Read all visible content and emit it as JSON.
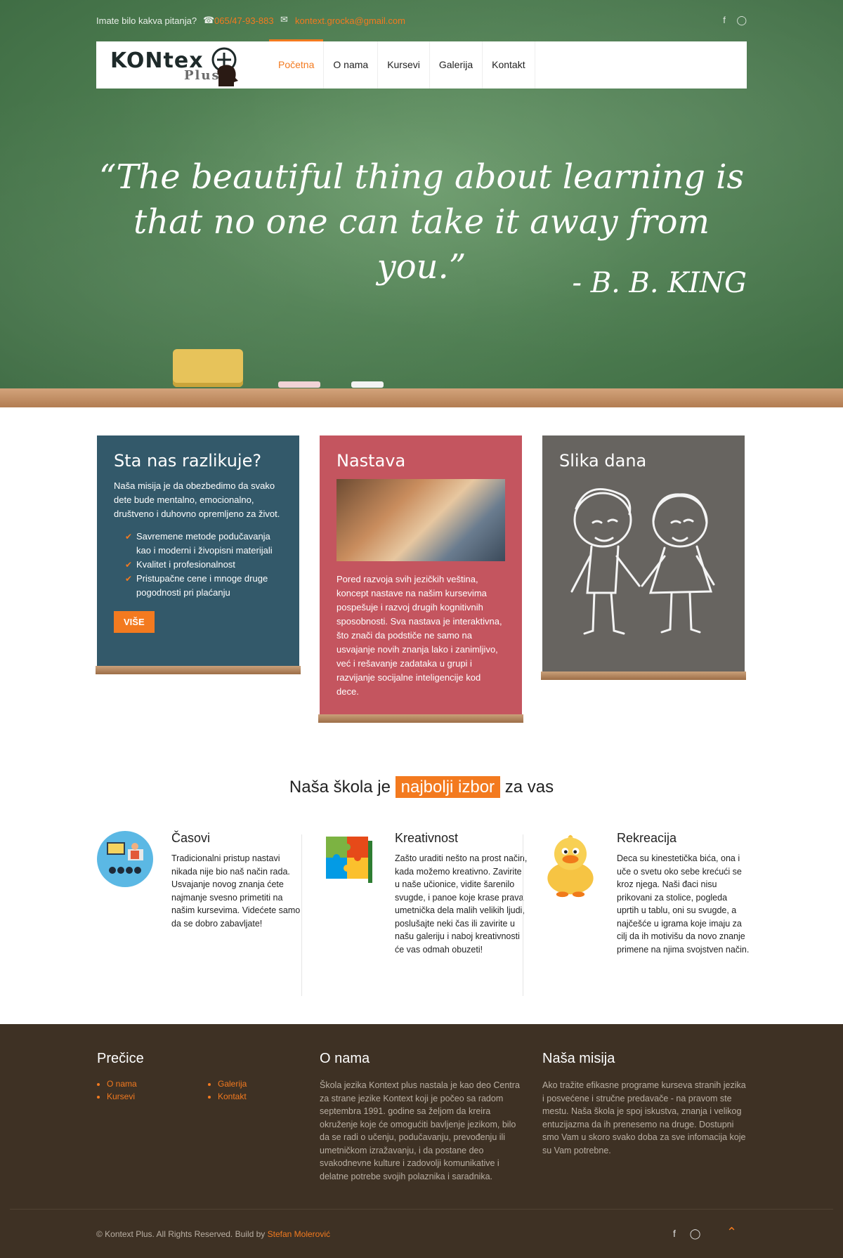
{
  "topbar": {
    "question": "Imate bilo kakva pitanja?",
    "phone": "065/47-93-883",
    "email": "kontext.grocka@gmail.com",
    "social": [
      "facebook-icon",
      "instagram-icon"
    ]
  },
  "logo": {
    "line1": "KONtex",
    "line2": "Plus"
  },
  "nav": [
    {
      "label": "Početna",
      "active": true
    },
    {
      "label": "O nama"
    },
    {
      "label": "Kursevi"
    },
    {
      "label": "Galerija"
    },
    {
      "label": "Kontakt"
    }
  ],
  "hero": {
    "quote": "“The beautiful thing about learning is that no one can take it away from you.”",
    "author": "- B. B. KING"
  },
  "cards": {
    "card1": {
      "title": "Sta nas razlikuje?",
      "text": "Naša misija je da obezbedimo da svako dete bude mentalno, emocionalno, društveno i duhovno opremljeno za život.",
      "checks": [
        "Savremene metode podučavanja kao i moderni i živopisni materijali",
        "Kvalitet i profesionalnost",
        "Pristupačne cene i mnoge druge pogodnosti pri plaćanju"
      ],
      "button": "VIŠE",
      "color": "#33596a"
    },
    "card2": {
      "title": "Nastava",
      "text": "Pored razvoja svih jezičkih veština, koncept nastave na našim kursevima pospešuje i razvoj drugih kognitivnih sposobnosti. Sva nastava je interaktivna, što znači da podstiče ne samo na usvajanje novih znanja lako i zanimljivo, već i rešavanje zadataka u grupi i razvijanje socijalne inteligencije kod dece.",
      "color": "#c4555f"
    },
    "card3": {
      "title": "Slika dana",
      "color": "#676460"
    }
  },
  "school": {
    "title_pre": "Naša škola je",
    "title_hl": "najbolji izbor",
    "title_post": "za vas",
    "features": [
      {
        "title": "Časovi",
        "icon": "classroom-icon",
        "text": "Tradicionalni pristup nastavi nikada nije bio naš način rada. Usvajanje novog znanja ćete najmanje svesno primetiti na našim kursevima. Videćete samo da se dobro zabavljate!"
      },
      {
        "title": "Kreativnost",
        "icon": "puzzle-icon",
        "text": "Zašto uraditi nešto na prost način, kada možemo kreativno. Zavirite u naše učionice, vidite šarenilo svugde, i panoe koje krase prava umetnička dela malih velikih ljudi, poslušajte neki čas ili zavirite u našu galeriju i naboj kreativnosti će vas odmah obuzeti!"
      },
      {
        "title": "Rekreacija",
        "icon": "duck-icon",
        "text": "Deca su kinestetička bića, ona i uče o svetu oko sebe krećući se kroz njega. Naši đaci nisu prikovani za stolice, pogleda uprtih u tablu, oni su svugde, a najčešće u igrama koje imaju za cilj da ih motivišu da novo znanje primene na njima svojstven način."
      }
    ]
  },
  "footer": {
    "shortcuts_title": "Prečice",
    "links_col1": [
      "O nama",
      "Kursevi"
    ],
    "links_col2": [
      "Galerija",
      "Kontakt"
    ],
    "about_title": "O nama",
    "about_text": "Škola jezika Kontext plus nastala je kao deo Centra za strane jezike Kontext koji je počeo sa radom septembra 1991. godine sa željom da kreira okruženje koje će omogućiti bavljenje jezikom, bilo da se radi o učenju, podučavanju, prevođenju ili umetničkom izražavanju, i da postane deo svakodnevne kulture i zadovolji komunikative i delatne potrebe svojih polaznika i saradnika.",
    "mission_title": "Naša misija",
    "mission_text": "Ako tražite efikasne programe kurseva stranih jezika i posvećene i stručne predavače - na pravom ste mestu. Naša škola je spoj iskustva, znanja i velikog entuzijazma da ih prenesemo na druge. Dostupni smo Vam u skoro svako doba za sve infomacija koje su Vam potrebne.",
    "copyright": "© Kontext Plus. All Rights Reserved. Build by",
    "author": "Stefan Molerović"
  },
  "colors": {
    "accent": "#f37a1f",
    "footer_bg": "#3e3124"
  }
}
